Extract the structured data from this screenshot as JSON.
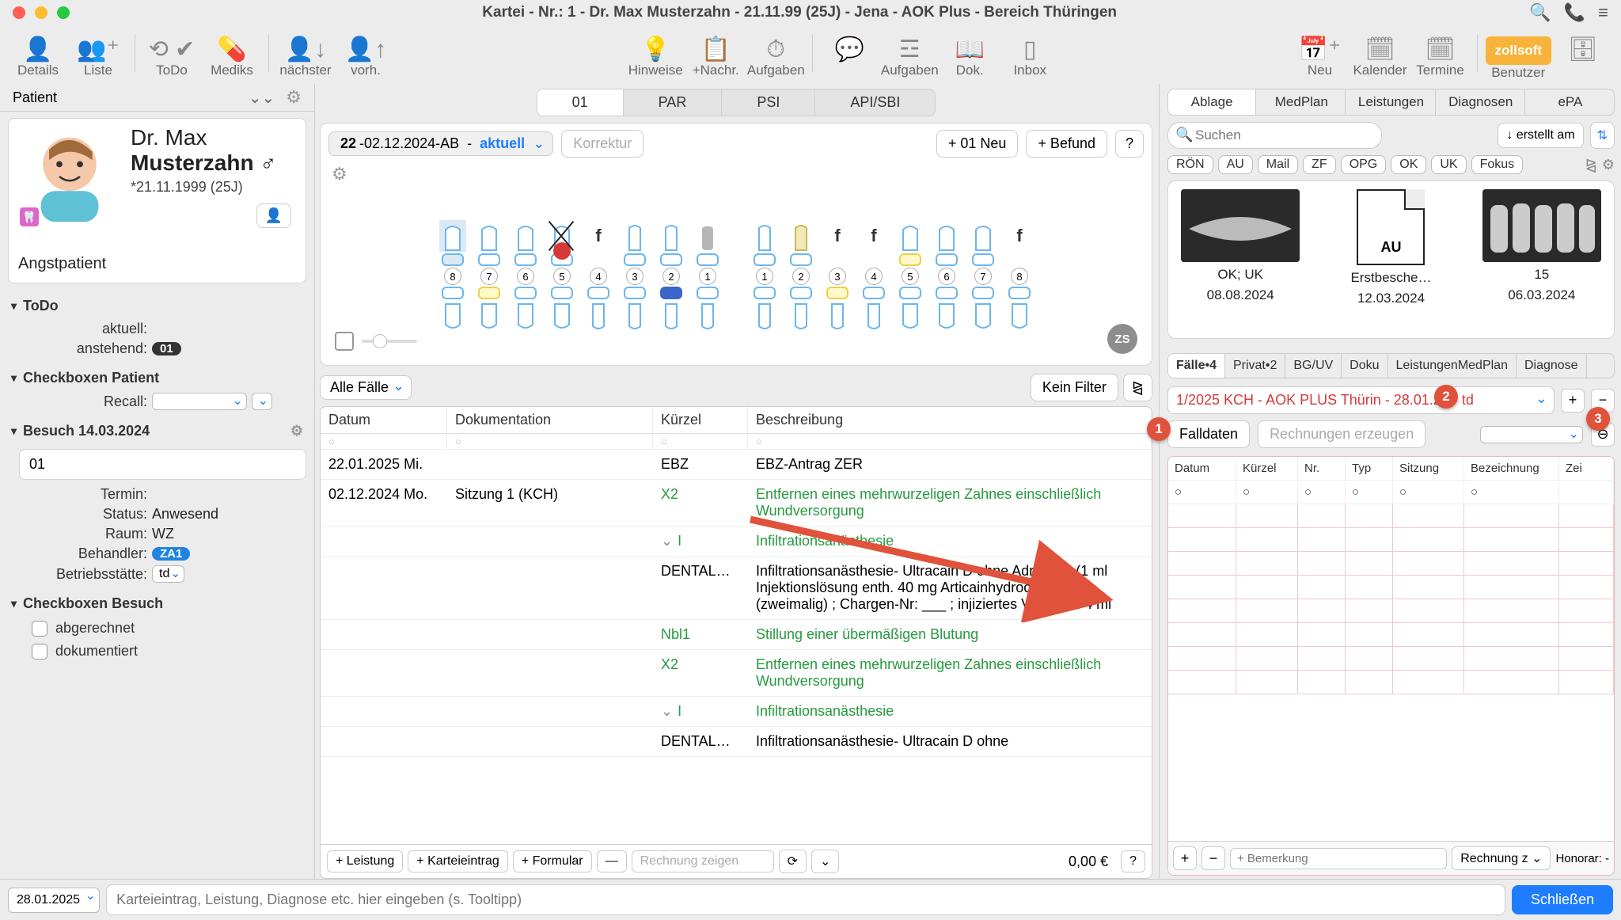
{
  "window": {
    "title": "Kartei - Nr.: 1 - Dr. Max Musterzahn - 21.11.99 (25J) - Jena - AOK Plus - Bereich Thüringen"
  },
  "toolbar": {
    "details": "Details",
    "liste": "Liste",
    "todo": "ToDo",
    "mediks": "Mediks",
    "naechster": "nächster",
    "vorh": "vorh.",
    "hinweise": "Hinweise",
    "nachr": "+Nachr.",
    "aufgaben": "Aufgaben",
    "dok": "Dok.",
    "inbox": "Inbox",
    "neu": "Neu",
    "kalender": "Kalender",
    "termine": "Termine",
    "benutzer": "Benutzer",
    "zollsoft": "zollsoft"
  },
  "patientbar": {
    "label": "Patient"
  },
  "patient": {
    "title": "Dr. Max",
    "name": "Musterzahn ♂",
    "birth": "*21.11.1999 (25J)",
    "status": "Angstpatient"
  },
  "sections": {
    "todo": {
      "title": "ToDo",
      "aktuell": "aktuell:",
      "anstehend": "anstehend:",
      "count": "01"
    },
    "cbpatient": {
      "title": "Checkboxen Patient",
      "recall": "Recall:"
    },
    "besuch": {
      "title": "Besuch 14.03.2024",
      "v01": "01",
      "termin": "Termin:",
      "status_k": "Status:",
      "status_v": "Anwesend",
      "raum_k": "Raum:",
      "raum_v": "WZ",
      "beh_k": "Behandler:",
      "beh_v": "ZA1",
      "bs_k": "Betriebsstätte:",
      "bs_v": "td"
    },
    "cbbesuch": {
      "title": "Checkboxen Besuch",
      "abg": "abgerechnet",
      "dok": "dokumentiert"
    }
  },
  "centerTabs": {
    "t1": "01",
    "t2": "PAR",
    "t3": "PSI",
    "t4": "API/SBI"
  },
  "teethbar": {
    "num": "22",
    "date": "02.12.2024",
    "mode": "AB",
    "state": "aktuell",
    "korrektur": "Korrektur",
    "neu": "+ 01 Neu",
    "befund": "+ Befund",
    "q": "?",
    "zs": "ZS"
  },
  "kartei": {
    "alle": "Alle Fälle",
    "kein": "Kein Filter",
    "cols": {
      "datum": "Datum",
      "doku": "Dokumentation",
      "kuerzel": "Kürzel",
      "besch": "Beschreibung"
    },
    "rows": [
      {
        "d": "22.01.2025 Mi.",
        "doc": "",
        "k": "EBZ",
        "b": "EBZ-Antrag ZER",
        "g": false
      },
      {
        "d": "02.12.2024 Mo.",
        "doc": "Sitzung 1 (KCH)",
        "k": "X2",
        "b": "Entfernen eines mehrwurzeligen Zahnes einschließlich Wundversorgung",
        "g": true
      },
      {
        "d": "",
        "doc": "",
        "k": "I",
        "b": "Infiltrationsanästhesie",
        "g": true,
        "expand": true
      },
      {
        "d": "",
        "doc": "",
        "k": "DENTAL…",
        "b": "Infiltrationsanästhesie- Ultracain D ohne Adrenalin (1 ml Injektionslösung enth. 40 mg Articainhydrochlorid.) (zweimalig) ; Chargen-Nr: ___ ; injiziertes Volumen: 4 ml",
        "g": false
      },
      {
        "d": "",
        "doc": "",
        "k": "Nbl1",
        "b": "Stillung einer übermäßigen Blutung",
        "g": true
      },
      {
        "d": "",
        "doc": "",
        "k": "X2",
        "b": "Entfernen eines mehrwurzeligen Zahnes einschließlich Wundversorgung",
        "g": true
      },
      {
        "d": "",
        "doc": "",
        "k": "I",
        "b": "Infiltrationsanästhesie",
        "g": true,
        "expand": true
      },
      {
        "d": "",
        "doc": "",
        "k": "DENTAL…",
        "b": "Infiltrationsanästhesie- Ultracain D ohne",
        "g": false
      }
    ],
    "footer": {
      "leistung": "+ Leistung",
      "eintrag": "+ Karteieintrag",
      "formular": "+ Formular",
      "rech": "Rechnung zeigen",
      "sum": "0,00 €"
    }
  },
  "bottom": {
    "date": "28.01.2025",
    "placeholder": "Karteieintrag, Leistung, Diagnose etc. hier eingeben (s. Tooltipp)",
    "close": "Schließen"
  },
  "right": {
    "tabs1": {
      "ablage": "Ablage",
      "medplan": "MedPlan",
      "leist": "Leistungen",
      "diag": "Diagnosen",
      "epa": "ePA"
    },
    "search_ph": "Suchen",
    "sort": "↓ erstellt am",
    "chips": {
      "ron": "RÖN",
      "au": "AU",
      "mail": "Mail",
      "zf": "ZF",
      "opg": "OPG",
      "ok": "OK",
      "uk": "UK",
      "fokus": "Fokus"
    },
    "thumbs": [
      {
        "t1": "OK; UK",
        "t2": "08.08.2024",
        "type": "img"
      },
      {
        "t1": "Erstbesche…",
        "t2": "12.03.2024",
        "type": "doc",
        "au": "AU"
      },
      {
        "t1": "15",
        "t2": "06.03.2024",
        "type": "img"
      }
    ],
    "tabs2": {
      "faelle": "Fälle•4",
      "privat": "Privat•2",
      "bguv": "BG/UV",
      "doku": "Doku",
      "leist": "LeistungenMedPlan",
      "diag": "Diagnose"
    },
    "case": "1/2025 KCH - AOK PLUS Thürin      - 28.01.25 - td",
    "falldaten": "Falldaten",
    "rech_erz": "Rechnungen erzeugen",
    "rtcols": {
      "datum": "Datum",
      "kuerzel": "Kürzel",
      "nr": "Nr.",
      "typ": "Typ",
      "sitz": "Sitzung",
      "bez": "Bezeichnung",
      "zei": "Zei"
    },
    "rfoot": {
      "bem": "+ Bemerkung",
      "rech": "Rechnung z",
      "hon": "Honorar: -"
    }
  },
  "badges": {
    "b1": "1",
    "b2": "2",
    "b3": "3"
  }
}
